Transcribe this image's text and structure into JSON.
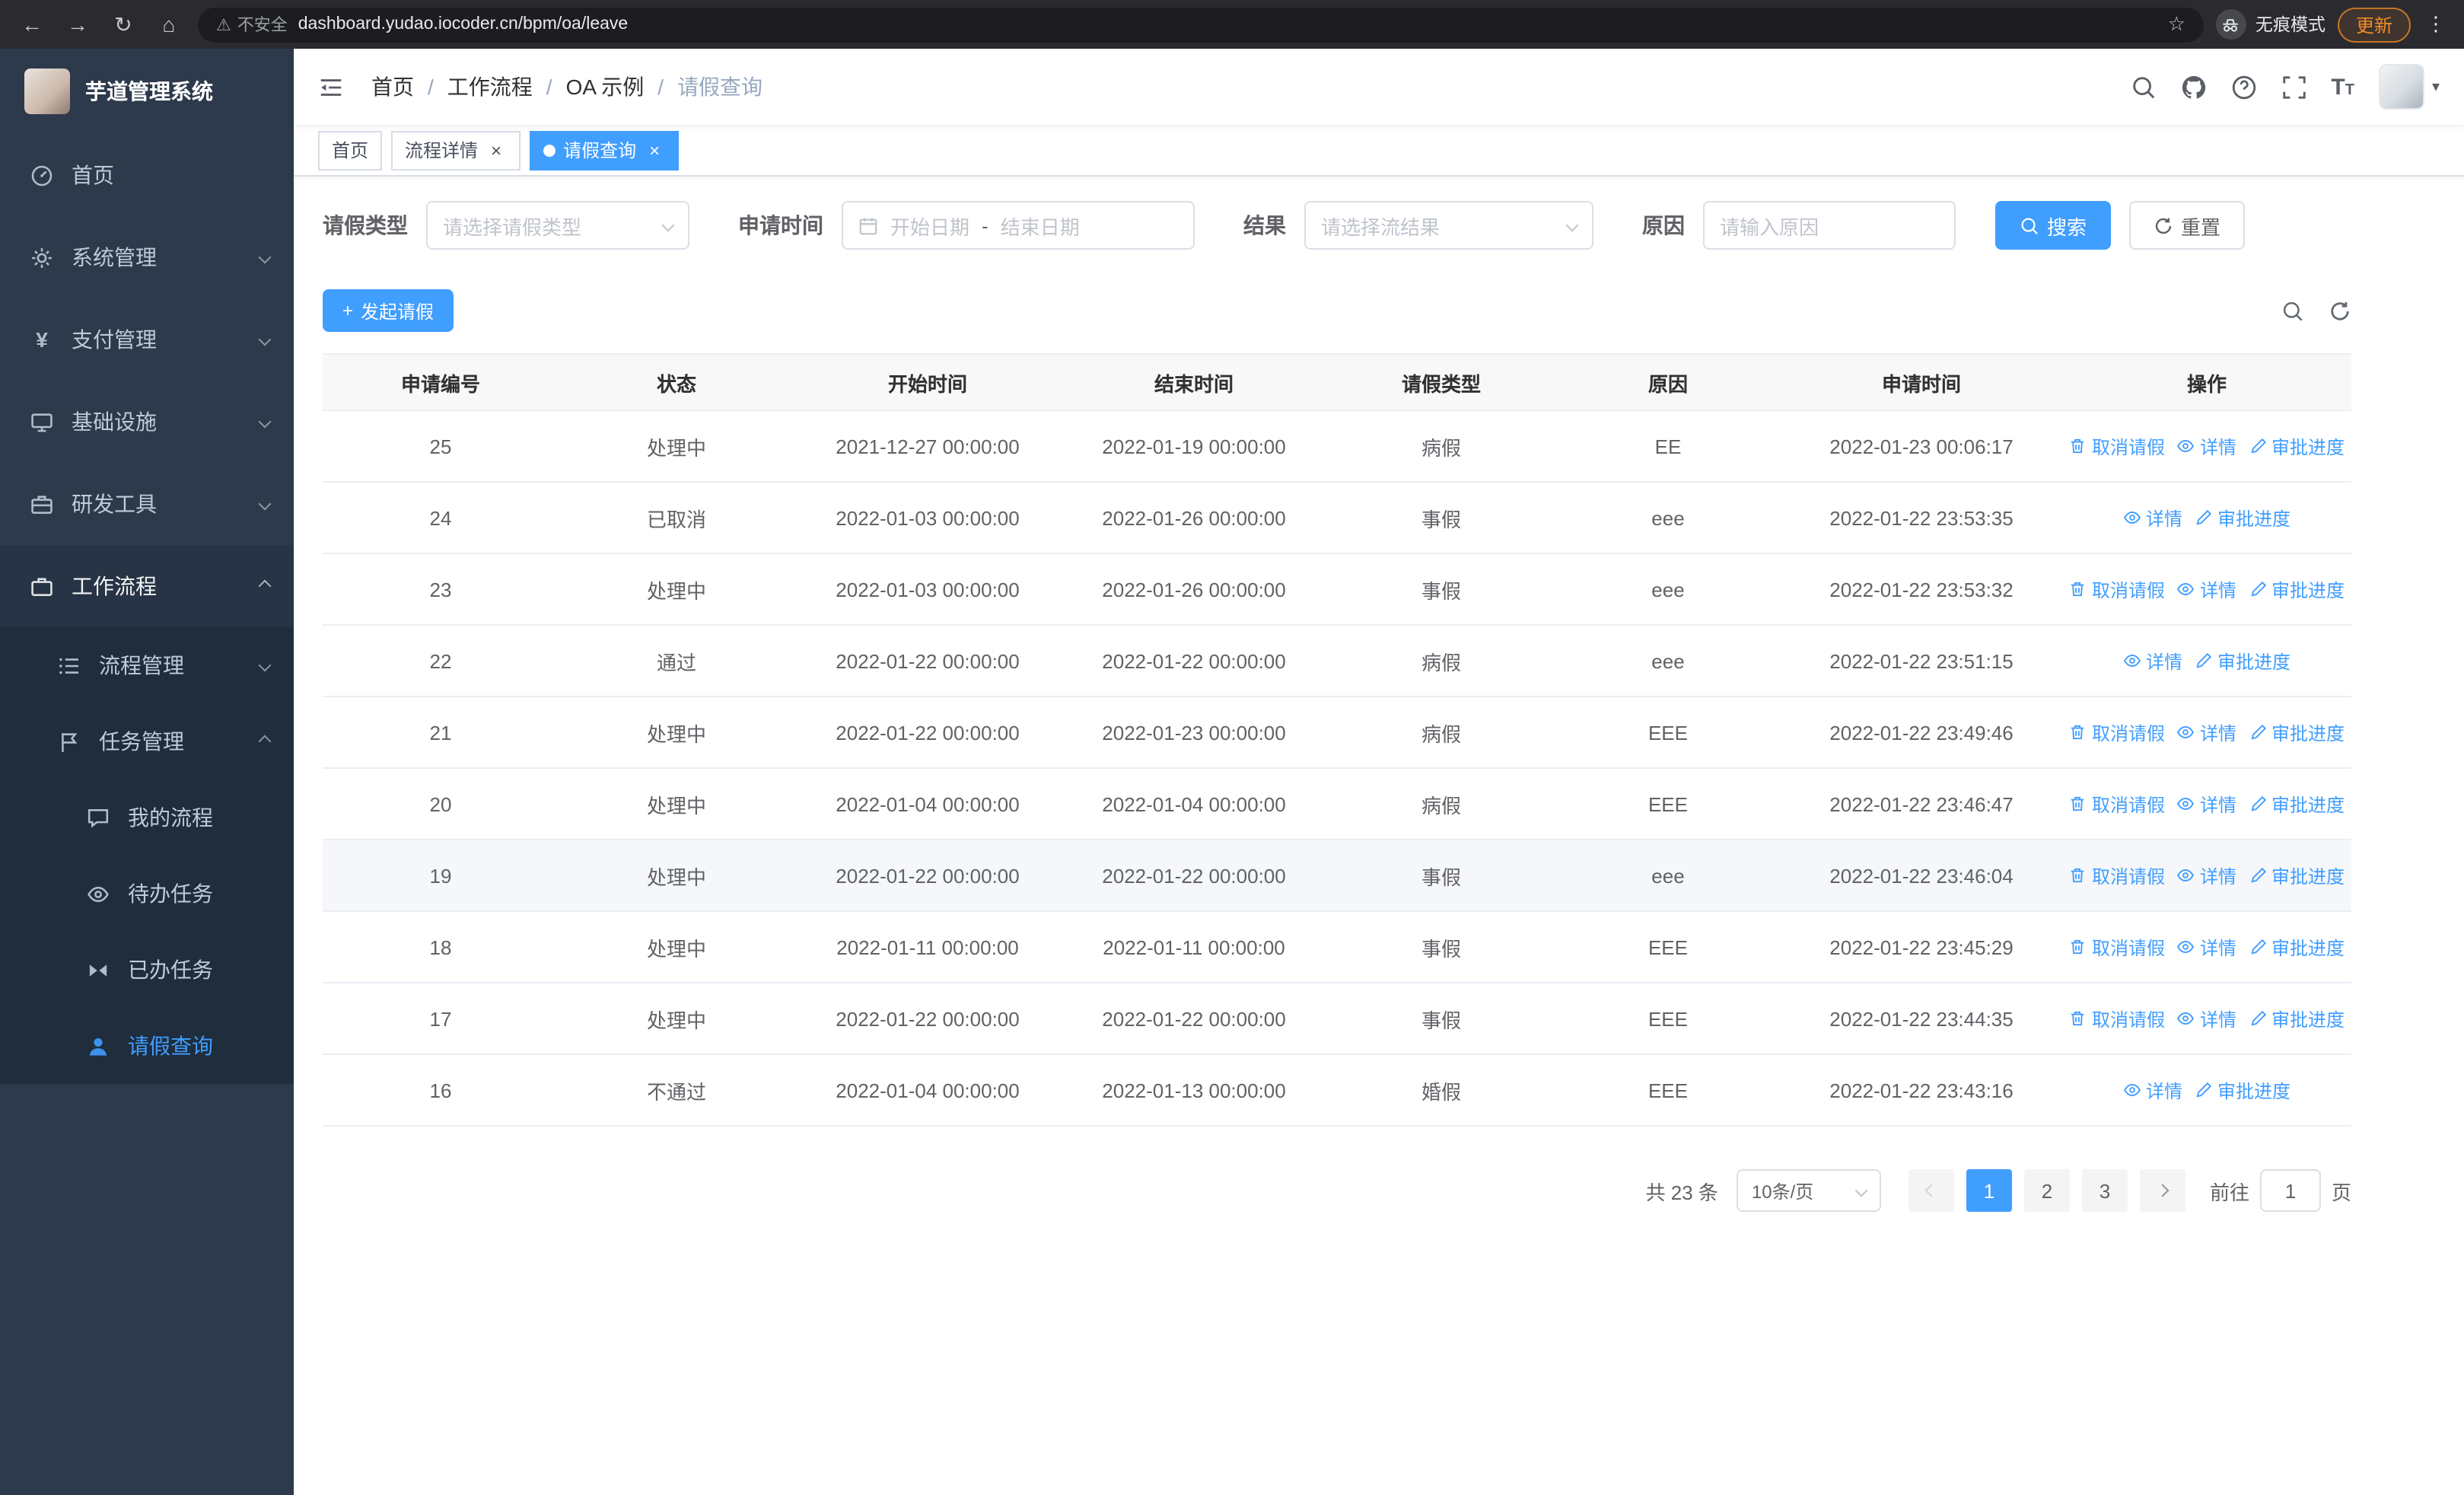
{
  "browser": {
    "url": "dashboard.yudao.iocoder.cn/bpm/oa/leave",
    "security_warning": "不安全",
    "incognito_label": "无痕模式",
    "update_label": "更新"
  },
  "icons": {
    "back": "←",
    "forward": "→",
    "reload": "↻",
    "home": "⌂",
    "warning": "⚠",
    "star": "☆",
    "menu_dots": "⋮",
    "plus": "+",
    "close": "×",
    "caret_down": "▾"
  },
  "sidebar": {
    "app_title": "芋道管理系统",
    "home": "首页",
    "system": "系统管理",
    "payment": "支付管理",
    "infra": "基础设施",
    "devtools": "研发工具",
    "workflow": "工作流程",
    "process_mgmt": "流程管理",
    "task_mgmt": "任务管理",
    "my_process": "我的流程",
    "todo_tasks": "待办任务",
    "done_tasks": "已办任务",
    "leave_query": "请假查询"
  },
  "header": {
    "breadcrumb": [
      "首页",
      "工作流程",
      "OA 示例",
      "请假查询"
    ],
    "breadcrumb_separator": "/"
  },
  "tabs": [
    {
      "label": "首页"
    },
    {
      "label": "流程详情"
    },
    {
      "label": "请假查询"
    }
  ],
  "filters": {
    "leave_type_label": "请假类型",
    "leave_type_placeholder": "请选择请假类型",
    "apply_time_label": "申请时间",
    "start_date_placeholder": "开始日期",
    "range_separator": "-",
    "end_date_placeholder": "结束日期",
    "result_label": "结果",
    "result_placeholder": "请选择流结果",
    "reason_label": "原因",
    "reason_placeholder": "请输入原因",
    "search_button": "搜索",
    "reset_button": "重置"
  },
  "toolbar": {
    "create_button": "发起请假"
  },
  "table": {
    "headers": [
      "申请编号",
      "状态",
      "开始时间",
      "结束时间",
      "请假类型",
      "原因",
      "申请时间",
      "操作"
    ],
    "action_labels": {
      "cancel": "取消请假",
      "detail": "详情",
      "progress": "审批进度"
    },
    "rows": [
      {
        "id": "25",
        "status": "处理中",
        "start": "2021-12-27 00:00:00",
        "end": "2022-01-19 00:00:00",
        "type": "病假",
        "reason": "EE",
        "applied": "2022-01-23 00:06:17",
        "can_cancel": true,
        "highlight": false
      },
      {
        "id": "24",
        "status": "已取消",
        "start": "2022-01-03 00:00:00",
        "end": "2022-01-26 00:00:00",
        "type": "事假",
        "reason": "eee",
        "applied": "2022-01-22 23:53:35",
        "can_cancel": false,
        "highlight": false
      },
      {
        "id": "23",
        "status": "处理中",
        "start": "2022-01-03 00:00:00",
        "end": "2022-01-26 00:00:00",
        "type": "事假",
        "reason": "eee",
        "applied": "2022-01-22 23:53:32",
        "can_cancel": true,
        "highlight": false
      },
      {
        "id": "22",
        "status": "通过",
        "start": "2022-01-22 00:00:00",
        "end": "2022-01-22 00:00:00",
        "type": "病假",
        "reason": "eee",
        "applied": "2022-01-22 23:51:15",
        "can_cancel": false,
        "highlight": false
      },
      {
        "id": "21",
        "status": "处理中",
        "start": "2022-01-22 00:00:00",
        "end": "2022-01-23 00:00:00",
        "type": "病假",
        "reason": "EEE",
        "applied": "2022-01-22 23:49:46",
        "can_cancel": true,
        "highlight": false
      },
      {
        "id": "20",
        "status": "处理中",
        "start": "2022-01-04 00:00:00",
        "end": "2022-01-04 00:00:00",
        "type": "病假",
        "reason": "EEE",
        "applied": "2022-01-22 23:46:47",
        "can_cancel": true,
        "highlight": false
      },
      {
        "id": "19",
        "status": "处理中",
        "start": "2022-01-22 00:00:00",
        "end": "2022-01-22 00:00:00",
        "type": "事假",
        "reason": "eee",
        "applied": "2022-01-22 23:46:04",
        "can_cancel": true,
        "highlight": true
      },
      {
        "id": "18",
        "status": "处理中",
        "start": "2022-01-11 00:00:00",
        "end": "2022-01-11 00:00:00",
        "type": "事假",
        "reason": "EEE",
        "applied": "2022-01-22 23:45:29",
        "can_cancel": true,
        "highlight": false
      },
      {
        "id": "17",
        "status": "处理中",
        "start": "2022-01-22 00:00:00",
        "end": "2022-01-22 00:00:00",
        "type": "事假",
        "reason": "EEE",
        "applied": "2022-01-22 23:44:35",
        "can_cancel": true,
        "highlight": false
      },
      {
        "id": "16",
        "status": "不通过",
        "start": "2022-01-04 00:00:00",
        "end": "2022-01-13 00:00:00",
        "type": "婚假",
        "reason": "EEE",
        "applied": "2022-01-22 23:43:16",
        "can_cancel": false,
        "highlight": false
      }
    ]
  },
  "pagination": {
    "total_text": "共 23 条",
    "page_size": "10条/页",
    "pages": [
      "1",
      "2",
      "3"
    ],
    "active_page": "1",
    "goto_label": "前往",
    "goto_value": "1",
    "goto_suffix": "页"
  },
  "colors": {
    "primary": "#409EFF",
    "sidebar_bg": "#2d3a4b",
    "submenu_bg": "#1f2d3d"
  }
}
